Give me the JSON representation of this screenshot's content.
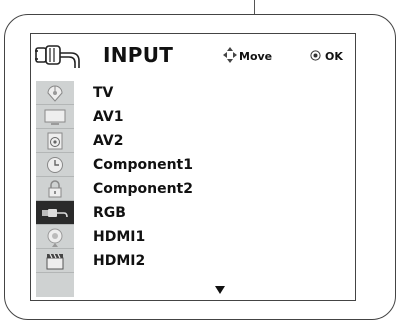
{
  "menu": {
    "title": "INPUT",
    "hint_move": "Move",
    "hint_ok": "OK",
    "selected_index": 5,
    "items": [
      {
        "label": "TV",
        "icon": "tv-antenna-icon"
      },
      {
        "label": "AV1",
        "icon": "monitor-icon"
      },
      {
        "label": "AV2",
        "icon": "speaker-icon"
      },
      {
        "label": "Component1",
        "icon": "clock-icon"
      },
      {
        "label": "Component2",
        "icon": "lock-icon"
      },
      {
        "label": "RGB",
        "icon": "input-cable-icon"
      },
      {
        "label": "HDMI1",
        "icon": "settings-icon"
      },
      {
        "label": "HDMI2",
        "icon": "clapperboard-icon"
      }
    ]
  }
}
